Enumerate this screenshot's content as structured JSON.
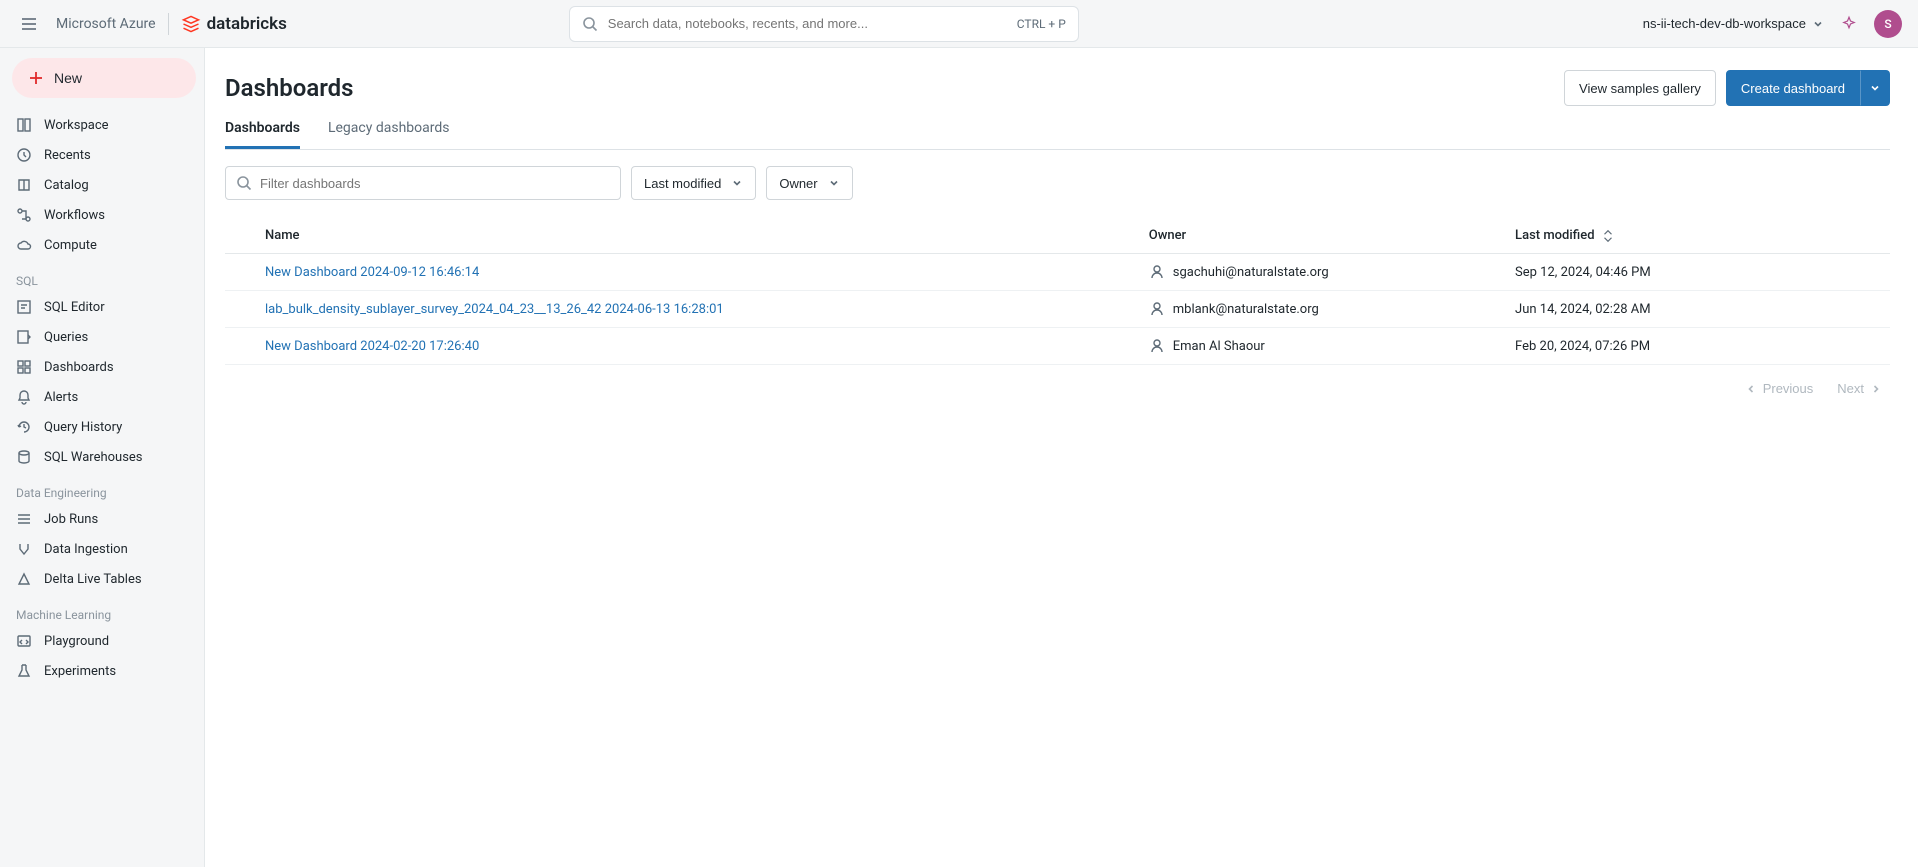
{
  "header": {
    "brand_azure": "Microsoft Azure",
    "brand_db": "databricks",
    "search_placeholder": "Search data, notebooks, recents, and more...",
    "search_shortcut": "CTRL + P",
    "workspace_name": "ns-ii-tech-dev-db-workspace",
    "avatar_initial": "S"
  },
  "sidebar": {
    "new_label": "New",
    "groups": [
      {
        "section": null,
        "items": [
          {
            "icon": "workspace-icon",
            "label": "Workspace"
          },
          {
            "icon": "clock-icon",
            "label": "Recents"
          },
          {
            "icon": "book-icon",
            "label": "Catalog"
          },
          {
            "icon": "flow-icon",
            "label": "Workflows"
          },
          {
            "icon": "cloud-icon",
            "label": "Compute"
          }
        ]
      },
      {
        "section": "SQL",
        "items": [
          {
            "icon": "editor-icon",
            "label": "SQL Editor"
          },
          {
            "icon": "query-icon",
            "label": "Queries"
          },
          {
            "icon": "dashboard-icon",
            "label": "Dashboards"
          },
          {
            "icon": "bell-icon",
            "label": "Alerts"
          },
          {
            "icon": "history-icon",
            "label": "Query History"
          },
          {
            "icon": "warehouse-icon",
            "label": "SQL Warehouses"
          }
        ]
      },
      {
        "section": "Data Engineering",
        "items": [
          {
            "icon": "jobs-icon",
            "label": "Job Runs"
          },
          {
            "icon": "ingestion-icon",
            "label": "Data Ingestion"
          },
          {
            "icon": "delta-icon",
            "label": "Delta Live Tables"
          }
        ]
      },
      {
        "section": "Machine Learning",
        "items": [
          {
            "icon": "playground-icon",
            "label": "Playground"
          },
          {
            "icon": "experiments-icon",
            "label": "Experiments"
          }
        ]
      }
    ]
  },
  "page": {
    "title": "Dashboards",
    "view_samples_label": "View samples gallery",
    "create_label": "Create dashboard"
  },
  "tabs": {
    "active": "Dashboards",
    "items": [
      "Dashboards",
      "Legacy dashboards"
    ]
  },
  "filters": {
    "search_placeholder": "Filter dashboards",
    "sort_label": "Last modified",
    "owner_label": "Owner"
  },
  "table": {
    "columns": {
      "name": "Name",
      "owner": "Owner",
      "modified": "Last modified"
    },
    "rows": [
      {
        "name": "New Dashboard 2024-09-12 16:46:14",
        "owner": "sgachuhi@naturalstate.org",
        "modified": "Sep 12, 2024, 04:46 PM"
      },
      {
        "name": "lab_bulk_density_sublayer_survey_2024_04_23__13_26_42 2024-06-13 16:28:01",
        "owner": "mblank@naturalstate.org",
        "modified": "Jun 14, 2024, 02:28 AM"
      },
      {
        "name": "New Dashboard 2024-02-20 17:26:40",
        "owner": "Eman Al Shaour",
        "modified": "Feb 20, 2024, 07:26 PM"
      }
    ]
  },
  "pagination": {
    "prev": "Previous",
    "next": "Next"
  }
}
